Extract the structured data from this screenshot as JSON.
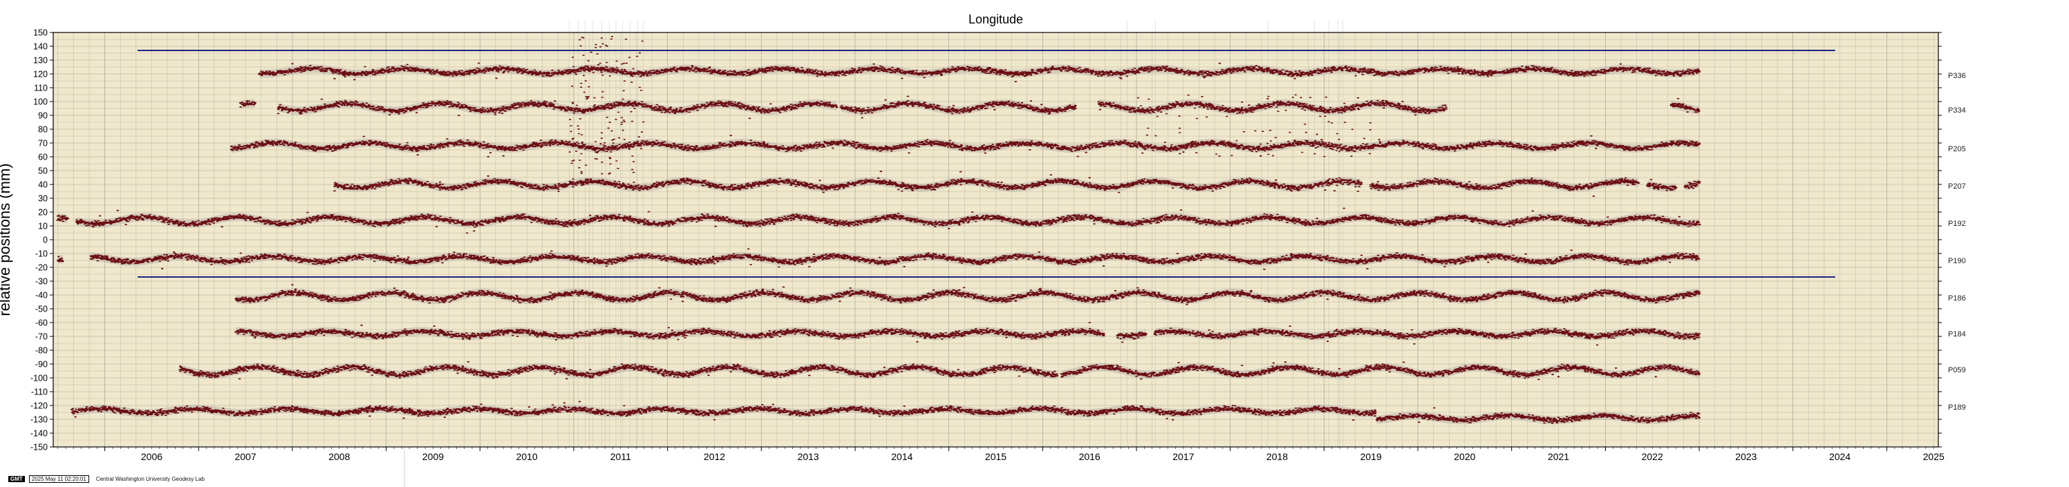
{
  "chart_data": {
    "type": "scatter",
    "title": "Longitude",
    "ylabel": "relative positions (mm)",
    "xlabel": "",
    "xlim": [
      2005.45,
      2025.55
    ],
    "ylim": [
      -150,
      150
    ],
    "x_ticks": [
      "2006",
      "2007",
      "2008",
      "2009",
      "2010",
      "2011",
      "2012",
      "2013",
      "2014",
      "2015",
      "2016",
      "2017",
      "2018",
      "2019",
      "2020",
      "2021",
      "2022",
      "2023",
      "2024",
      "2025"
    ],
    "y_ticks": [
      150,
      140,
      130,
      120,
      110,
      100,
      90,
      80,
      70,
      60,
      50,
      40,
      30,
      20,
      10,
      0,
      -10,
      -20,
      -30,
      -40,
      -50,
      -60,
      -70,
      -80,
      -90,
      -100,
      -110,
      -120,
      -130,
      -140,
      -150
    ],
    "grid": true,
    "reference_lines": [
      {
        "y": 137,
        "x_start": 2006.35,
        "x_end": 2024.45,
        "color": "#1a237e"
      },
      {
        "y": -27,
        "x_start": 2006.35,
        "x_end": 2024.45,
        "color": "#1a237e"
      }
    ],
    "series": [
      {
        "name": "P336",
        "offset": 122,
        "segments": [
          [
            2007.65,
            2023.0
          ]
        ],
        "label_y": 119
      },
      {
        "name": "P334",
        "offset": 96,
        "segments": [
          [
            2007.45,
            2007.6
          ],
          [
            2007.85,
            2013.8
          ],
          [
            2013.85,
            2016.35
          ],
          [
            2016.6,
            2020.3
          ],
          [
            2022.7,
            2023.0
          ]
        ],
        "label_y": 94
      },
      {
        "name": "P205",
        "offset": 68,
        "segments": [
          [
            2007.35,
            2023.0
          ]
        ],
        "label_y": 66
      },
      {
        "name": "P207",
        "offset": 40,
        "segments": [
          [
            2008.45,
            2019.4
          ],
          [
            2019.5,
            2022.35
          ],
          [
            2022.45,
            2022.75
          ],
          [
            2022.85,
            2023.0
          ]
        ],
        "label_y": 39
      },
      {
        "name": "P192",
        "offset": 14,
        "segments": [
          [
            2005.5,
            2005.6
          ],
          [
            2005.7,
            2023.0
          ]
        ],
        "label_y": 12
      },
      {
        "name": "P190",
        "offset": -14,
        "segments": [
          [
            2005.5,
            2005.55
          ],
          [
            2005.85,
            2023.0
          ]
        ],
        "label_y": -15
      },
      {
        "name": "P186",
        "offset": -41,
        "segments": [
          [
            2007.4,
            2023.0
          ]
        ],
        "label_y": -42
      },
      {
        "name": "P184",
        "offset": -68,
        "segments": [
          [
            2007.4,
            2016.65
          ],
          [
            2016.8,
            2017.1
          ],
          [
            2017.2,
            2023.0
          ]
        ],
        "label_y": -68
      },
      {
        "name": "P059",
        "offset": -95,
        "segments": [
          [
            2006.8,
            2016.15
          ],
          [
            2016.2,
            2023.0
          ]
        ],
        "label_y": -94
      },
      {
        "name": "P189",
        "offset": -124,
        "segments": [
          [
            2005.65,
            2023.0
          ]
        ],
        "label_y": -121
      }
    ],
    "colors": {
      "plot_bg": "#efe8cc",
      "grid": "#8c8878",
      "points": "#6a0d12",
      "error_band": "#b3a9a4",
      "ref_line": "#1a237e"
    }
  },
  "footer": {
    "badge": "GMT",
    "timestamp": "2025 May 11 02:20:01",
    "org": "Central Washington University Geodesy Lab"
  }
}
